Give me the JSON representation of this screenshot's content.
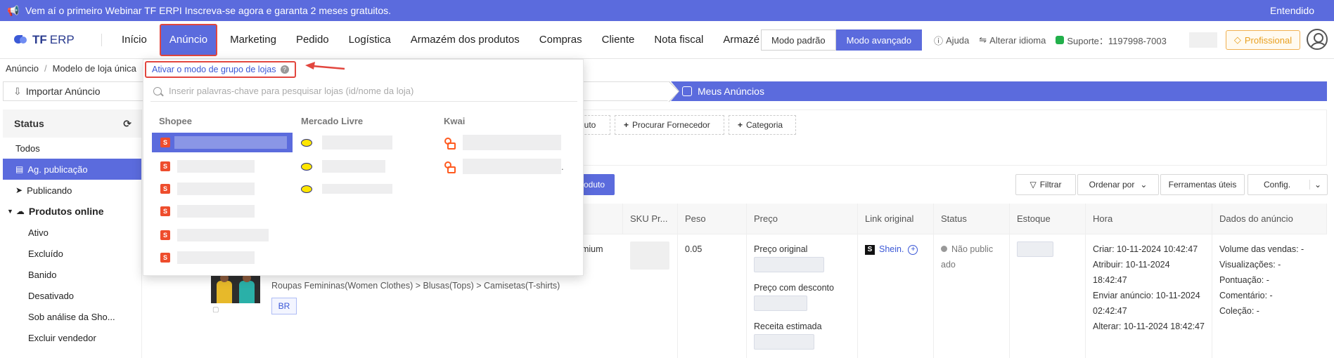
{
  "banner": {
    "message": "Vem aí o primeiro Webinar TF ERPI Inscreva-se agora e garanta 2 meses gratuitos.",
    "dismiss": "Entendido",
    "icon": "megaphone-icon"
  },
  "brand": {
    "name": "TF",
    "suffix": "ERP"
  },
  "nav": {
    "items": [
      "Início",
      "Anúncio",
      "Marketing",
      "Pedido",
      "Logística",
      "Armazém dos produtos",
      "Compras",
      "Cliente",
      "Nota fiscal",
      "Armazé"
    ],
    "active_index": 1,
    "more": "›"
  },
  "mode": {
    "standard": "Modo padrão",
    "advanced": "Modo avançado",
    "selected": "advanced"
  },
  "topright": {
    "help": "Ajuda",
    "language": "Alterar idioma",
    "support": "Suporte：1197998-7003",
    "plan": "Profissional"
  },
  "breadcrumb": [
    "Anúncio",
    "Modelo de loja única"
  ],
  "steps": {
    "import": "Importar Anúncio",
    "mine": "Meus Anúncios"
  },
  "sidebar": {
    "title": "Status",
    "items": [
      {
        "label": "Todos",
        "kind": "top"
      },
      {
        "label": "Ag. publicação",
        "kind": "active"
      },
      {
        "label": "Publicando",
        "kind": "top"
      },
      {
        "label": "Produtos online",
        "kind": "group"
      },
      {
        "label": "Ativo",
        "kind": "sub"
      },
      {
        "label": "Excluído",
        "kind": "sub"
      },
      {
        "label": "Banido",
        "kind": "sub"
      },
      {
        "label": "Desativado",
        "kind": "sub"
      },
      {
        "label": "Sob análise da Sho...",
        "kind": "sub"
      },
      {
        "label": "Excluir vendedor",
        "kind": "sub"
      }
    ]
  },
  "filters": {
    "chip1": "duto",
    "chip2": "Procurar Fornecedor",
    "chip3": "Categoria"
  },
  "toolbar": {
    "primary_fragment": "oduto",
    "filter": "Filtrar",
    "sort": "Ordenar por",
    "tools": "Ferramentas úteis",
    "config": "Config."
  },
  "table": {
    "headers": [
      "SKU Pr...",
      "Peso",
      "Preço",
      "Link original",
      "Status",
      "Estoque",
      "Hora",
      "Dados do anúncio"
    ],
    "row": {
      "title_fragment": "emium",
      "category": "Roupas Femininas(Women Clothes) > Blusas(Tops) > Camisetas(T-shirts)",
      "site": "BR",
      "weight": "0.05",
      "price_labels": [
        "Preço original",
        "Preço com desconto",
        "Receita estimada"
      ],
      "link": "Shein.",
      "status": "Não public ado",
      "time": {
        "created": "Criar:   10-11-2024 10:42:47",
        "assigned": "Atribuir:   10-11-2024 18:42:47",
        "sent": "Enviar anúncio:   10-11-2024 02:42:47",
        "changed": "Alterar:   10-11-2024 18:42:47"
      },
      "listing_data": [
        "Volume das vendas:   -",
        "Visualizações:   -",
        "Pontuação:   -",
        "Comentário:   -",
        "Coleção:   -"
      ]
    }
  },
  "dropdown": {
    "group_toggle": "Ativar o modo de grupo de lojas",
    "search_placeholder": "Inserir palavras-chave para pesquisar lojas (id/nome da loja)",
    "columns": [
      "Shopee",
      "Mercado Livre",
      "Kwai"
    ],
    "kwai_trailing": "."
  },
  "colors": {
    "accent": "#5b6bdd",
    "highlight": "#e2463e",
    "link": "#3a57d6",
    "plan": "#e8a020"
  }
}
